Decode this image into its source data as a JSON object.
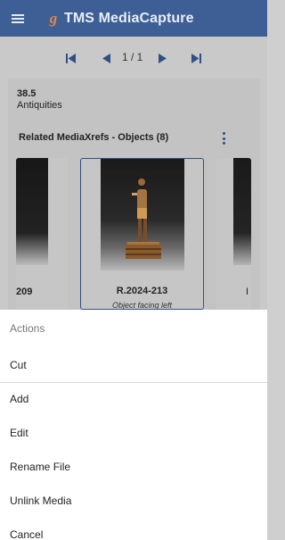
{
  "appbar": {
    "title": "TMS MediaCapture",
    "logo_letter": "g"
  },
  "pager": {
    "label": "1 / 1"
  },
  "card": {
    "number": "38.5",
    "subtitle": "Antiquities",
    "related_title": "Related MediaXrefs - Objects (8)"
  },
  "thumbnails": [
    {
      "label": "209",
      "caption": ""
    },
    {
      "label": "R.2024-213",
      "caption": "Object facing left"
    },
    {
      "label": "I",
      "caption": ""
    }
  ],
  "sheet": {
    "header": "Actions",
    "items": [
      "Cut",
      "Add",
      "Edit",
      "Rename File",
      "Unlink Media",
      "Cancel"
    ]
  },
  "colors": {
    "accent": "#3d5f96",
    "logo": "#e2844c"
  }
}
